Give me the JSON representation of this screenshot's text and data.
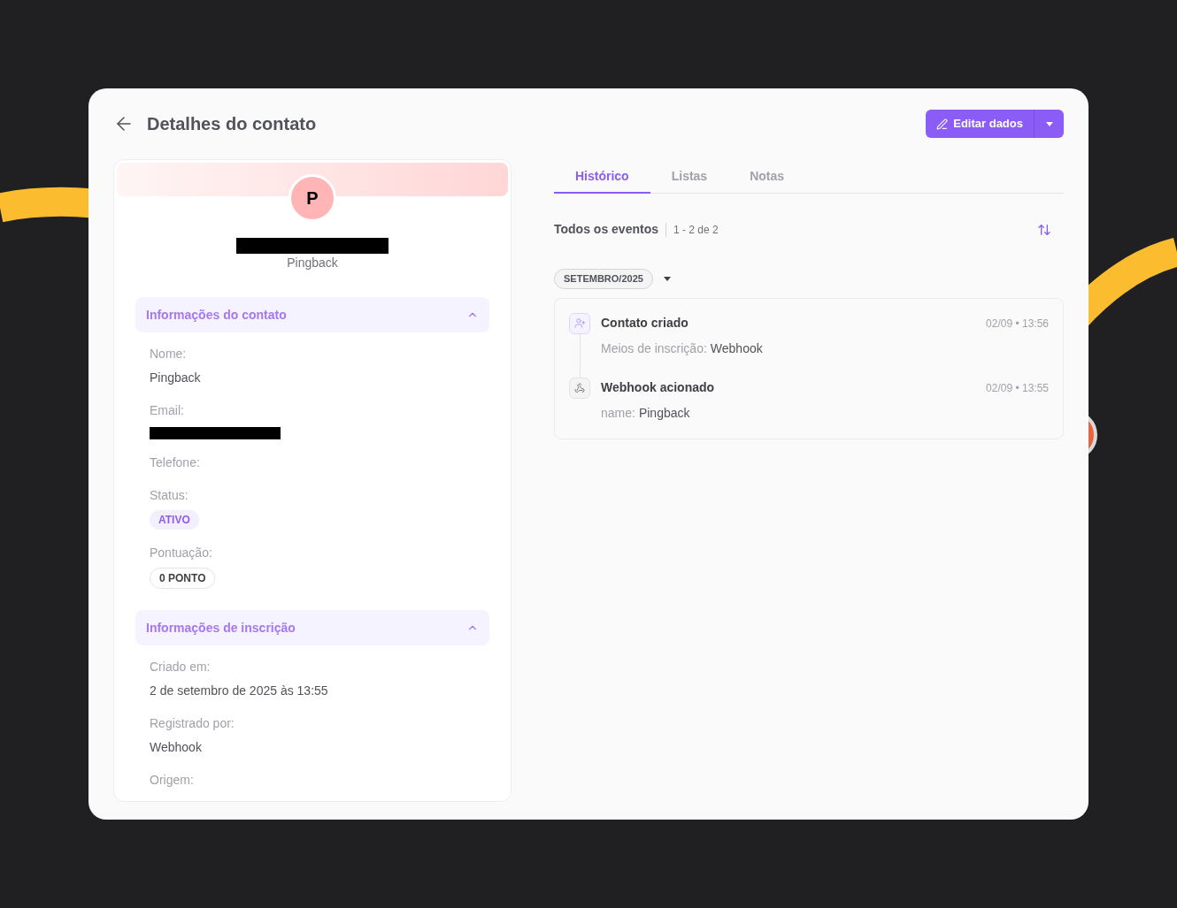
{
  "header": {
    "title": "Detalhes do contato",
    "edit_button": "Editar dados"
  },
  "profile": {
    "initial": "P",
    "subtitle": "Pingback"
  },
  "sections": [
    {
      "title": "Informações do contato",
      "expanded": true,
      "fields": [
        {
          "label": "Nome:",
          "kind": "text",
          "value": "Pingback"
        },
        {
          "label": "Email:",
          "kind": "redacted"
        },
        {
          "label": "Telefone:",
          "kind": "empty"
        },
        {
          "label": "Status:",
          "kind": "status",
          "value": "ATIVO"
        },
        {
          "label": "Pontuação:",
          "kind": "score",
          "value": "0 PONTO"
        }
      ]
    },
    {
      "title": "Informações de inscrição",
      "expanded": true,
      "fields": [
        {
          "label": "Criado em:",
          "kind": "text",
          "value": "2 de setembro de 2025 às 13:55"
        },
        {
          "label": "Registrado por:",
          "kind": "text",
          "value": "Webhook"
        },
        {
          "label": "Origem:",
          "kind": "empty"
        }
      ]
    }
  ],
  "tabs": [
    {
      "label": "Histórico",
      "selected": true
    },
    {
      "label": "Listas",
      "selected": false
    },
    {
      "label": "Notas",
      "selected": false
    }
  ],
  "events_header": {
    "title": "Todos os eventos",
    "count": "1 - 2 de 2"
  },
  "month": "SETEMBRO/2025",
  "events": [
    {
      "kind": "contact",
      "title": "Contato criado",
      "time": "02/09 • 13:56",
      "detail_label": "Meios de inscrição:",
      "detail_value": "Webhook"
    },
    {
      "kind": "webhook",
      "title": "Webhook acionado",
      "time": "02/09 • 13:55",
      "detail_label": "name:",
      "detail_value": "Pingback"
    }
  ]
}
